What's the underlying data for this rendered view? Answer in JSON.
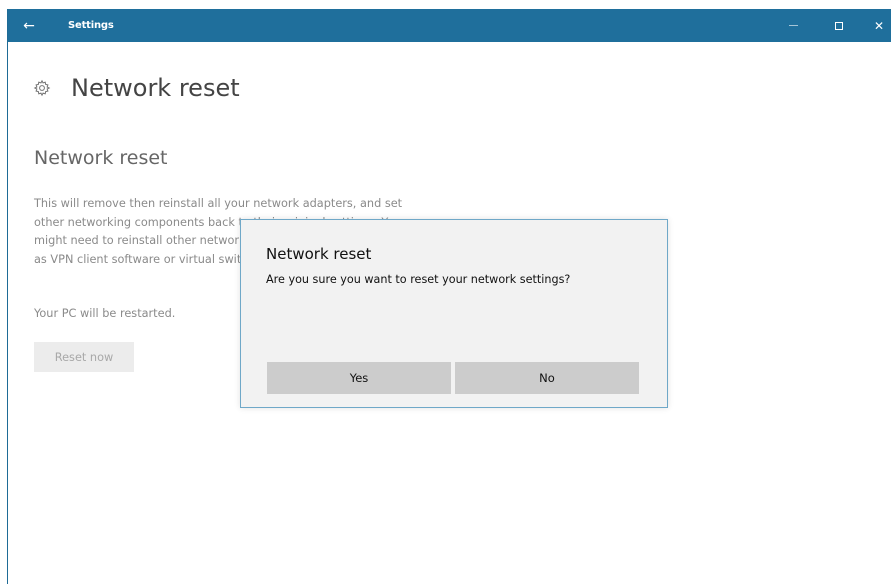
{
  "titlebar": {
    "back_icon": "←",
    "title": "Settings",
    "close_icon": "✕"
  },
  "page": {
    "title": "Network reset",
    "header_icon": "gear-icon"
  },
  "section": {
    "title": "Network reset",
    "description_lines": [
      "This will remove then reinstall all your network adapters, and set",
      "other networking components back to their original settings. You",
      "might need to reinstall other networking software afterwards, such",
      "as VPN client software or virtual switches."
    ],
    "restart_note": "Your PC will be restarted.",
    "reset_button": "Reset now"
  },
  "dialog": {
    "title": "Network reset",
    "message": "Are you sure you want to reset your network settings?",
    "yes_label": "Yes",
    "no_label": "No"
  },
  "colors": {
    "titlebar": "#1f6f9c",
    "dialog_border": "#6fa8c8",
    "dialog_bg": "#f2f2f2",
    "dialog_button": "#cccccc"
  }
}
